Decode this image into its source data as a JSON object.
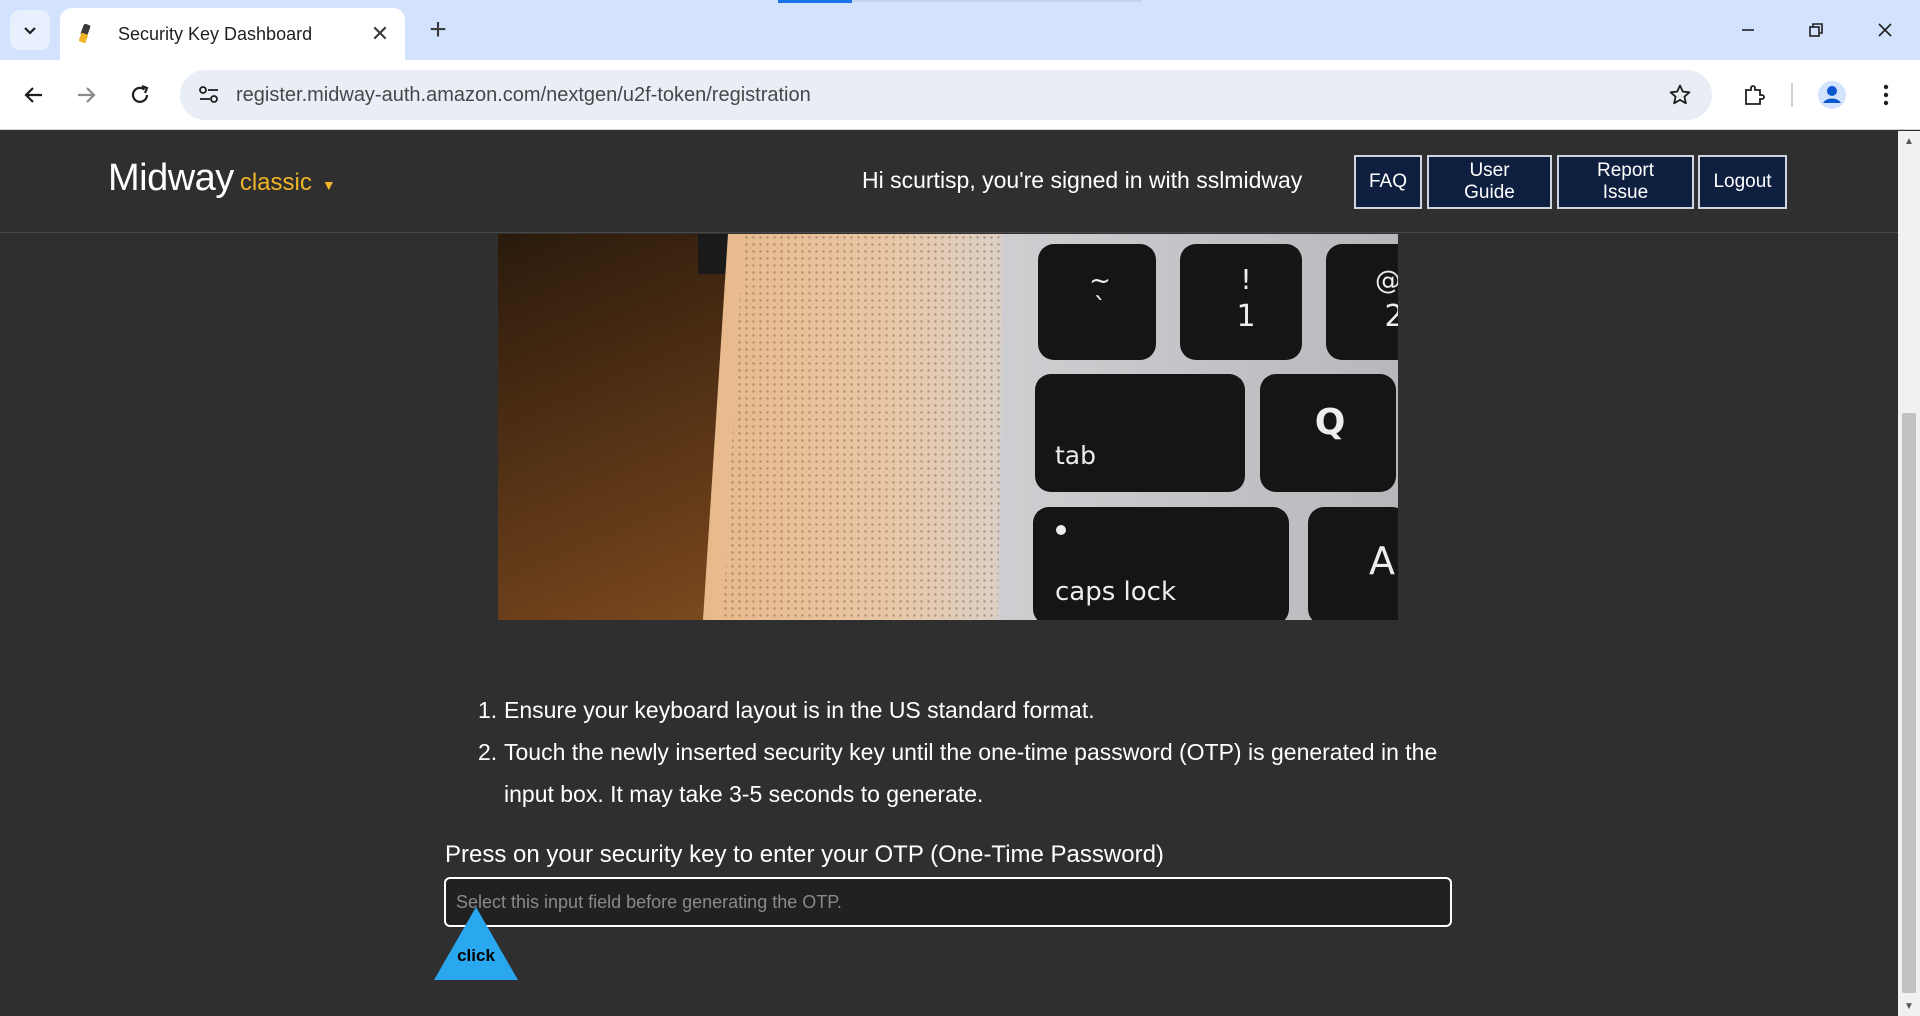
{
  "browser": {
    "tab_title": "Security Key Dashboard",
    "tab_close": "✕",
    "new_tab": "+",
    "url": "register.midway-auth.amazon.com/nextgen/u2f-token/registration",
    "icons": {
      "tab_search": "chevron-down-icon",
      "favicon": "security-key-icon",
      "back": "arrow-left-icon",
      "forward": "arrow-right-icon",
      "reload": "reload-icon",
      "site_info": "tune-icon",
      "bookmark": "star-icon",
      "extensions": "puzzle-icon",
      "profile": "profile-icon",
      "menu": "kebab-menu-icon",
      "minimize": "minimize-icon",
      "restore": "restore-icon",
      "close": "close-icon"
    }
  },
  "header": {
    "brand": "Midway",
    "mode": "classic",
    "mode_caret": "▼",
    "greeting": "Hi scurtisp, you're signed in with sslmidway",
    "buttons": {
      "faq": "FAQ",
      "user_guide": "User Guide",
      "report_issue": "Report Issue",
      "logout": "Logout"
    }
  },
  "photo": {
    "keys": {
      "tilde": "~",
      "backtick": "`",
      "exclaim": "!",
      "one": "1",
      "at": "@",
      "two": "2",
      "tab": "tab",
      "q": "Q",
      "caps": "caps lock",
      "a": "A"
    }
  },
  "instructions": {
    "steps": [
      {
        "num": "1.",
        "text": "Ensure your keyboard layout is in the US standard format."
      },
      {
        "num": "2.",
        "text": "Touch the newly inserted security key until the one-time password (OTP) is generated in the input box. It may take 3-5 seconds to generate."
      }
    ]
  },
  "otp": {
    "label": "Press on your security key to enter your OTP (One-Time Password)",
    "placeholder": "Select this input field before generating the OTP.",
    "value": ""
  },
  "annotation": {
    "label": "click",
    "color": "#29a8f0"
  },
  "scrollbar": {
    "up": "▲",
    "down": "▼"
  },
  "colors": {
    "page_bg": "#2f2f2f",
    "accent": "#f0b429",
    "button_bg": "#0f1f40"
  }
}
